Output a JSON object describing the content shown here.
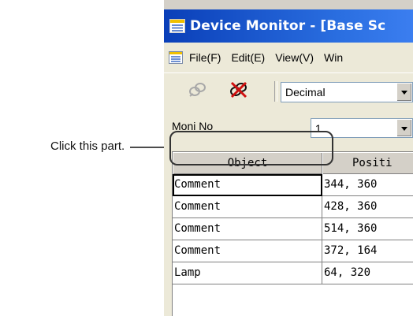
{
  "callout": {
    "text": "Click this part."
  },
  "window": {
    "title": "Device Monitor - [Base Sc"
  },
  "menu": {
    "items": [
      {
        "label": "File(F)"
      },
      {
        "label": "Edit(E)"
      },
      {
        "label": "View(V)"
      },
      {
        "label": "Win"
      }
    ]
  },
  "toolbar": {
    "format_value": "Decimal"
  },
  "panel": {
    "moni_label": "Moni No",
    "moni_value": "1"
  },
  "table": {
    "columns": [
      "Object",
      "Positi"
    ],
    "rows": [
      {
        "object": "Comment",
        "position": "344, 360"
      },
      {
        "object": "Comment",
        "position": "428, 360"
      },
      {
        "object": "Comment",
        "position": "514, 360"
      },
      {
        "object": "Comment",
        "position": "372, 164"
      },
      {
        "object": "Lamp",
        "position": "64, 320"
      }
    ]
  },
  "colors": {
    "title_bar": "#0a3fb8",
    "chrome": "#ece9d8",
    "highlight": "#333333"
  },
  "icons": [
    "app-icon",
    "menu-doc-icon",
    "connect-icon",
    "disconnect-icon",
    "dropdown-arrow-icon"
  ]
}
